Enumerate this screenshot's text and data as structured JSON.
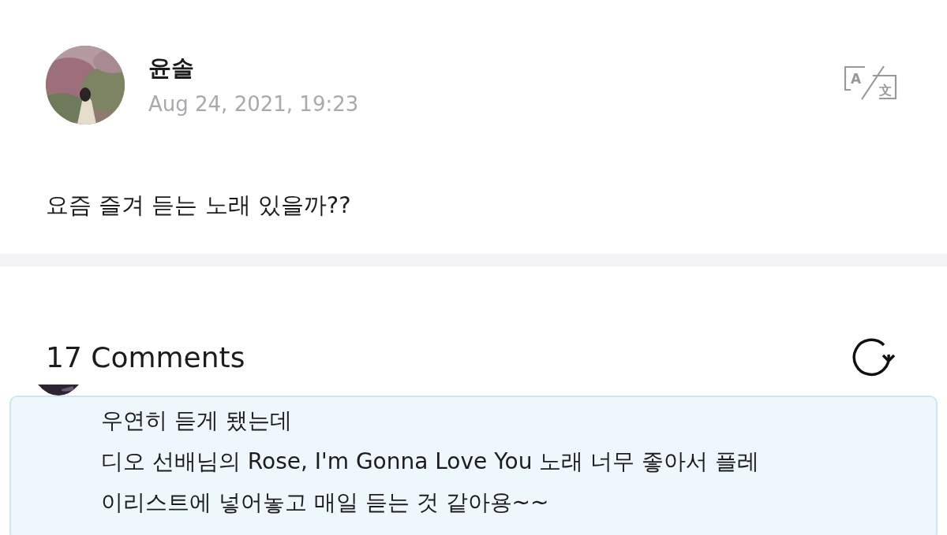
{
  "post": {
    "author": "윤솔",
    "time": "Aug 24, 2021, 19:23",
    "avatar": {
      "kind": "picture"
    },
    "text": "요즘 즐겨 듣는 노래 있을까??",
    "translate_glyphs": [
      "A",
      "文"
    ]
  },
  "comments_header": {
    "count_label": "17 Comments"
  },
  "comments": [
    {
      "avatar": {
        "kind": "picture"
      },
      "lines": [
        "우연히 듣게 됐는데",
        "디오 선배님의 Rose, I'm Gonna Love You 노래 너무 좋아서 플레",
        "이리스트에 넣어놓고 매일 듣는 것 같아용~~"
      ]
    }
  ]
}
